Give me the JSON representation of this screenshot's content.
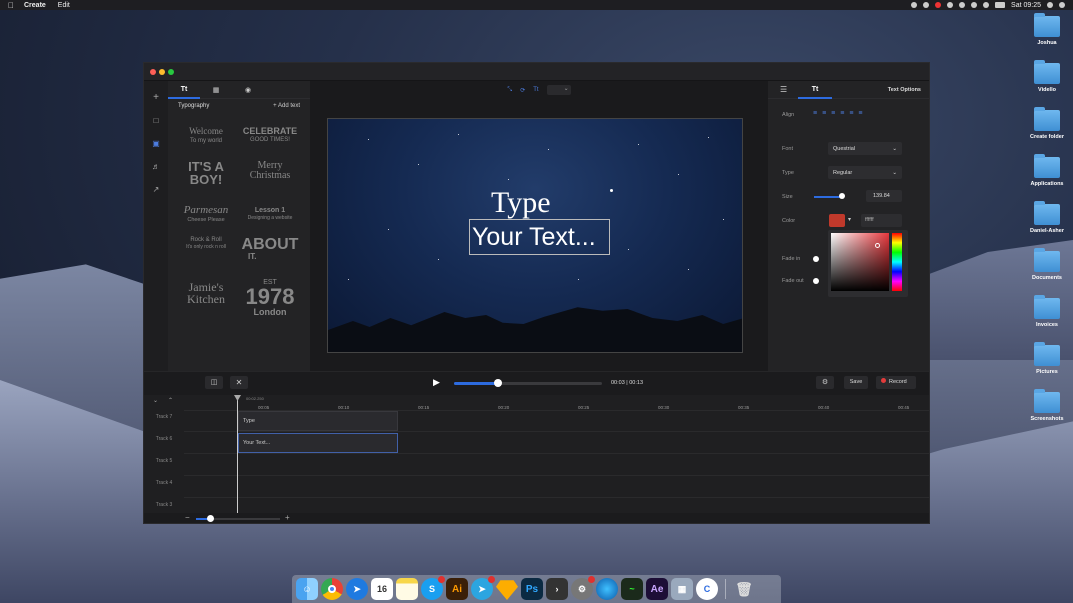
{
  "menubar": {
    "app": "Create",
    "edit": "Edit",
    "clock": "Sat 09:25"
  },
  "desktop": {
    "icons": [
      "Joshua",
      "Vidello",
      "Create folder",
      "Applications",
      "Daniel-Asher",
      "Documents",
      "Invoices",
      "Pictures",
      "Screenshots"
    ]
  },
  "left_panel": {
    "tab_text": "Tt",
    "section_title": "Typography",
    "add_text": "+ Add text",
    "templates": [
      {
        "line1": "Welcome",
        "line2": "To my world"
      },
      {
        "line1": "CELEBRATE",
        "line2": "GOOD TIMES!"
      },
      {
        "line1": "IT'S A",
        "line2": "BOY!"
      },
      {
        "line1": "Merry",
        "line2": "Christmas"
      },
      {
        "line1": "Parmesan",
        "line2": "Cheese Please"
      },
      {
        "line1": "Lesson 1",
        "line2": "Designing a website"
      },
      {
        "line1": "Rock & Roll",
        "line2": "It's only rock n roll"
      },
      {
        "line1": "ABOUT",
        "line2": "IT."
      },
      {
        "line1": "Jamie's",
        "line2": "Kitchen"
      },
      {
        "line1": "EST",
        "line2": "1978"
      },
      {
        "line1": "London",
        "line2": ""
      }
    ]
  },
  "canvas": {
    "title": "Type",
    "subtitle": "Your Text..."
  },
  "right_panel": {
    "tab_text": "Tt",
    "header": "Text Options",
    "align_label": "Align",
    "font_label": "Font",
    "font_value": "Questrial",
    "type_label": "Type",
    "type_value": "Regular",
    "size_label": "Size",
    "size_value": "139.84",
    "color_label": "Color",
    "color_hex": "#c0392b",
    "color_value": "ffffff",
    "fade_in_label": "Fade in",
    "fade_out_label": "Fade out"
  },
  "transport": {
    "time": "00:03 | 00:13",
    "save": "Save",
    "record": "Record",
    "progress": 0.3
  },
  "timeline": {
    "playhead": "00:02.250",
    "ruler": [
      "00:05",
      "00:10",
      "00:15",
      "00:20",
      "00:25",
      "00:30",
      "00:35",
      "00:40",
      "00:45"
    ],
    "tracks": [
      "Track 7",
      "Track 6",
      "Track 5",
      "Track 4",
      "Track 3"
    ],
    "clips": [
      "Type",
      "Your Text..."
    ]
  },
  "dock": {
    "apps": [
      "Finder",
      "Chrome",
      "Safari",
      "Calendar",
      "Notes",
      "Skype",
      "Illustrator",
      "Telegram",
      "Sketch",
      "Photoshop",
      "Terminal",
      "System Preferences",
      "Edge",
      "Activity",
      "After Effects",
      "Preview",
      "Create",
      "Trash"
    ],
    "calendar_day": "16"
  }
}
